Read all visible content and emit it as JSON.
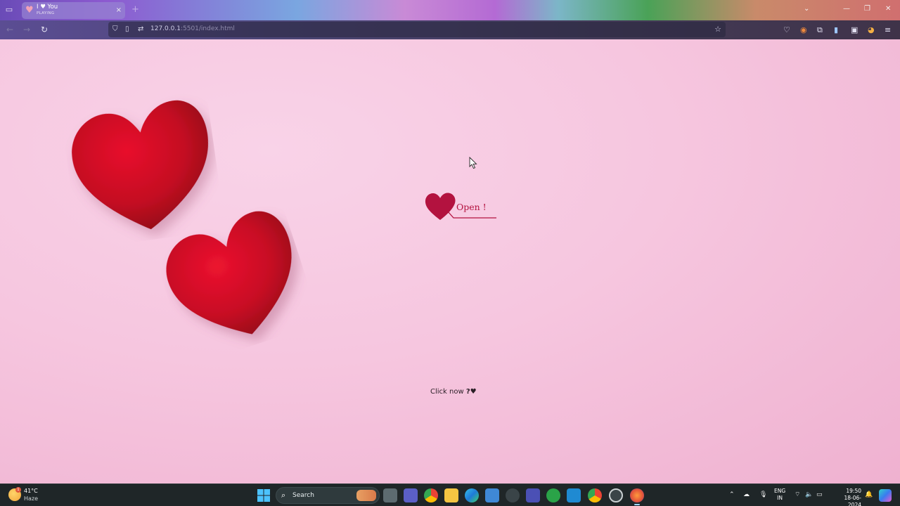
{
  "browser": {
    "tab": {
      "title": "I ♥ You",
      "subtitle": "PLAYING",
      "close_glyph": "×"
    },
    "new_tab_glyph": "+",
    "url": {
      "host": "127.0.0.1",
      "path": ":5501/index.html"
    },
    "window_controls": {
      "list_all": "⌄",
      "minimize": "—",
      "restore": "❐",
      "close": "✕"
    },
    "nav": {
      "back_glyph": "←",
      "forward_glyph": "→",
      "reload_glyph": "↻"
    }
  },
  "page": {
    "open_button_label": "Open !",
    "click_now_text": "Click now ",
    "click_now_emoji": "?♥",
    "accent_color": "#b3123f",
    "background_color": "#f6c6de"
  },
  "taskbar": {
    "weather": {
      "temp": "41°C",
      "desc": "Haze",
      "badge": "1"
    },
    "search_label": "Search",
    "language": {
      "line1": "ENG",
      "line2": "IN"
    },
    "clock": {
      "time": "19:50",
      "date": "18-06-2024"
    }
  }
}
